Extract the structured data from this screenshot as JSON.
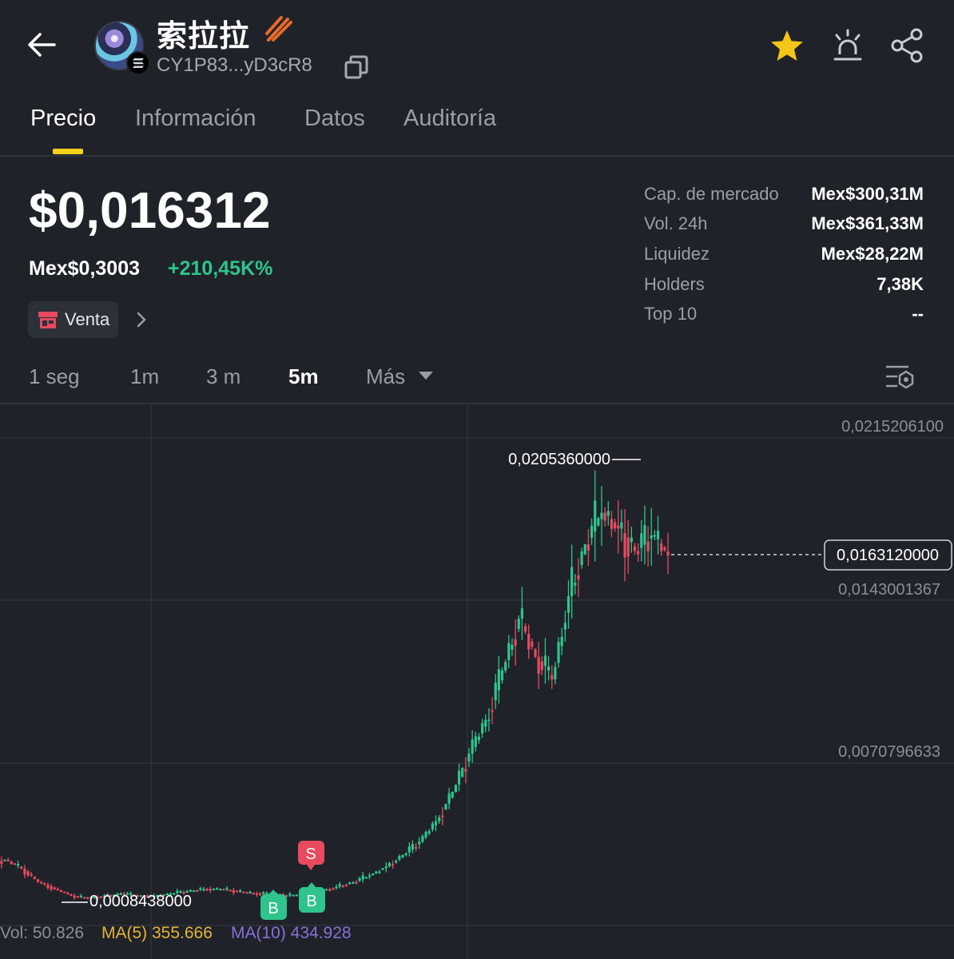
{
  "header": {
    "token_name": "索拉拉",
    "address": "CY1P83...yD3cR8"
  },
  "tabs": [
    {
      "label": "Precio",
      "active": true
    },
    {
      "label": "Información",
      "active": false
    },
    {
      "label": "Datos",
      "active": false
    },
    {
      "label": "Auditoría",
      "active": false
    }
  ],
  "price": {
    "usd": "$0,016312",
    "local": "Mex$0,3003",
    "change": "+210,45K%"
  },
  "sell_button": {
    "label": "Venta"
  },
  "stats": [
    {
      "label": "Cap. de mercado",
      "value": "Mex$300,31M"
    },
    {
      "label": "Vol. 24h",
      "value": "Mex$361,33M"
    },
    {
      "label": "Liquidez",
      "value": "Mex$28,22M"
    },
    {
      "label": "Holders",
      "value": "7,38K"
    },
    {
      "label": "Top 10",
      "value": "--"
    }
  ],
  "intervals": [
    {
      "label": "1 seg",
      "active": false
    },
    {
      "label": "1m",
      "active": false
    },
    {
      "label": "3 m",
      "active": false
    },
    {
      "label": "5m",
      "active": true
    },
    {
      "label": "Más",
      "active": false
    }
  ],
  "chart": {
    "y_ticks": [
      "0,0215206100",
      "0,0143001367",
      "0,0070796633"
    ],
    "high_label": "0,0205360000",
    "low_label": "0,0008438000",
    "current_label": "0,0163120000",
    "markers": [
      "S",
      "B",
      "B"
    ]
  },
  "volume_legend": {
    "vol": "Vol: 50.826",
    "ma5": "MA(5) 355.666",
    "ma10": "MA(10) 434.928"
  },
  "colors": {
    "background": "#1f2229",
    "up": "#2fc48d",
    "down": "#e84a5f",
    "accent": "#f5d21b",
    "ma5": "#e6b23a",
    "ma10": "#8b6fd6"
  },
  "chart_data": {
    "type": "candlestick",
    "y_ticks": [
      0.02152061,
      0.0143001367,
      0.0070796633
    ],
    "high": 0.020536,
    "low": 0.0008438,
    "current": 0.016312,
    "closes_approx": [
      0.0028,
      0.0024,
      0.0018,
      0.0015,
      0.0012,
      0.0011,
      0.0012,
      0.0013,
      0.0012,
      0.0012,
      0.0013,
      0.0014,
      0.0015,
      0.0015,
      0.0014,
      0.0013,
      0.0013,
      0.0012,
      0.0013,
      0.0014,
      0.0016,
      0.0018,
      0.0021,
      0.0025,
      0.003,
      0.0036,
      0.0045,
      0.0058,
      0.0075,
      0.009,
      0.0112,
      0.0135,
      0.0118,
      0.0108,
      0.0145,
      0.0168,
      0.0182,
      0.0175,
      0.0165,
      0.0172,
      0.0163
    ]
  }
}
